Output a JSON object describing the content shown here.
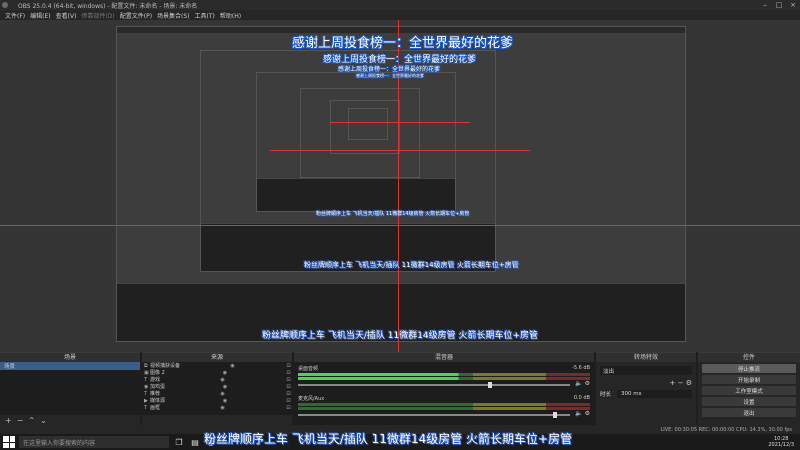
{
  "window": {
    "title": "OBS 25.0.4 (64-bit, windows) - 配置文件: 未命名 - 场景: 未命名"
  },
  "menu": [
    {
      "label": "文件(F)",
      "disabled": false
    },
    {
      "label": "编辑(E)",
      "disabled": false
    },
    {
      "label": "查看(V)",
      "disabled": false
    },
    {
      "label": "停靠部件(D)",
      "disabled": true
    },
    {
      "label": "配置文件(P)",
      "disabled": false
    },
    {
      "label": "场景集合(S)",
      "disabled": false
    },
    {
      "label": "工具(T)",
      "disabled": false
    },
    {
      "label": "帮助(H)",
      "disabled": false
    }
  ],
  "overlay": {
    "title_big": "感谢上周投食榜一：全世界最好的花爹",
    "title_2": "感谢上周投食榜一：全世界最好的花爹",
    "title_3": "感谢上周投食榜一：全世界最好的花爹",
    "title_4": "感谢上周投食榜一：全世界最好的花爹",
    "banner": "粉丝牌顺序上车 飞机当天/插队 11微群14级房管 火箭长期车位+房管"
  },
  "docks": {
    "scenes": {
      "title": "场景",
      "items": [
        {
          "label": "场景"
        }
      ]
    },
    "sources": {
      "title": "来源",
      "items": [
        {
          "icon": "⧉",
          "label": "视频捕获设备"
        },
        {
          "icon": "▣",
          "label": "图像 2"
        },
        {
          "icon": "T",
          "label": "游戏"
        },
        {
          "icon": "◉",
          "label": "加鸡蛋"
        },
        {
          "icon": "T",
          "label": "推荐"
        },
        {
          "icon": "▶",
          "label": "媒体源"
        },
        {
          "icon": "T",
          "label": "画框"
        }
      ]
    },
    "mixer": {
      "title": "混音器",
      "channels": [
        {
          "label": "桌面音频",
          "db": "-5.6 dB",
          "active": true
        },
        {
          "label": "麦克风/Aux",
          "db": "0.0 dB",
          "active": false
        }
      ]
    },
    "transitions": {
      "title": "转场特效",
      "type": "淡出",
      "duration_label": "时长",
      "duration_value": "300 ms"
    },
    "controls": {
      "title": "控件",
      "buttons": [
        "停止推流",
        "开始录制",
        "工作室模式",
        "设置",
        "退出"
      ]
    }
  },
  "statusbar": {
    "text": "LIVE: 00:30:05   REC: 00:00:00   CPU: 14.3%, 30.00 fps"
  },
  "taskbar": {
    "search_placeholder": "在这里输入你要搜索的内容",
    "time": "10:28",
    "date": "2021/12/3"
  }
}
